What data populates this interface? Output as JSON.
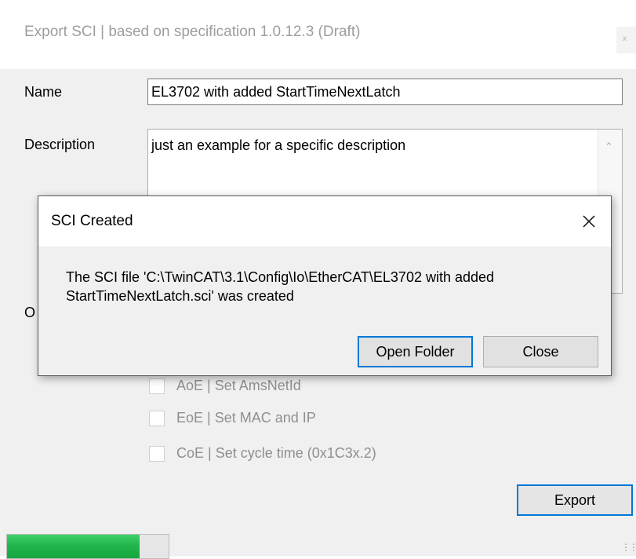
{
  "main_window": {
    "title": "Export SCI | based on specification 1.0.12.3 (Draft)",
    "close_glyph": "x",
    "name_label": "Name",
    "name_value": "EL3702 with added StartTimeNextLatch",
    "description_label": "Description",
    "description_value": "just an example for a specific description",
    "options_label_partial": "O",
    "options": [
      {
        "label": "AoE | Set AmsNetId",
        "checked": false
      },
      {
        "label": "EoE | Set MAC and IP",
        "checked": false
      },
      {
        "label": "CoE | Set cycle time (0x1C3x.2)",
        "checked": false
      }
    ],
    "export_button": "Export",
    "progress_fraction": 0.82
  },
  "dialog": {
    "title": "SCI Created",
    "message": "The SCI file 'C:\\TwinCAT\\3.1\\Config\\Io\\EtherCAT\\EL3702 with added\nStartTimeNextLatch.sci' was created",
    "open_folder_button": "Open Folder",
    "close_button": "Close"
  },
  "colors": {
    "accent": "#0078d7",
    "progress": "#1fb44a",
    "window_bg": "#f0f0f0"
  }
}
